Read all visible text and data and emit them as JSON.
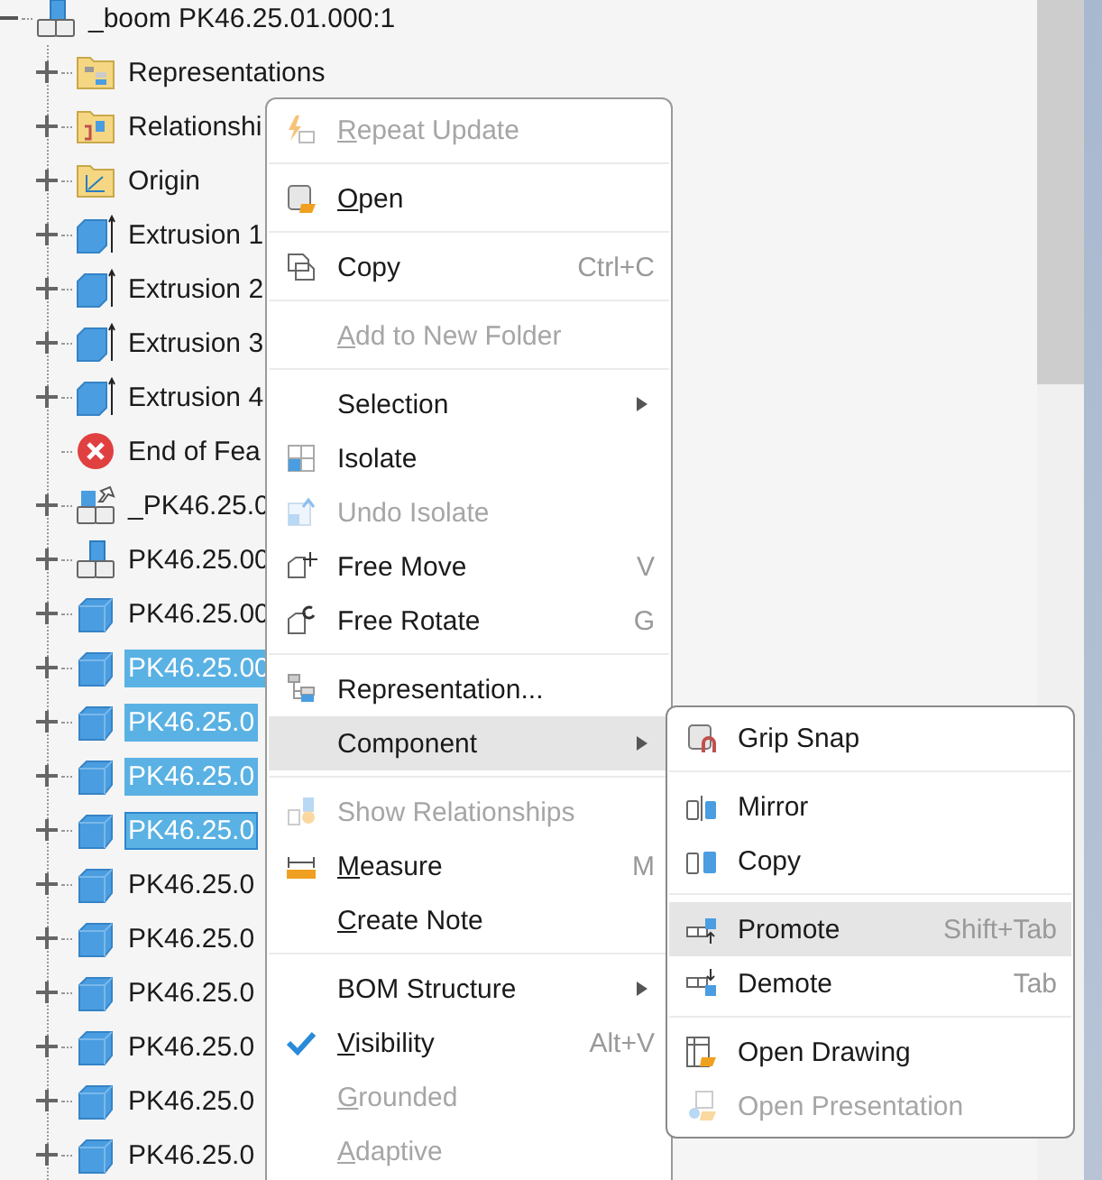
{
  "tree": {
    "root": {
      "label": "_boom PK46.25.01.000:1",
      "kind": "assembly",
      "expanded": true,
      "selected": false,
      "focused": false,
      "children": [
        {
          "label": "Representations",
          "kind": "representations",
          "expanded": false,
          "selected": false,
          "focused": false
        },
        {
          "label": "Relationshi",
          "kind": "relationships",
          "expanded": false,
          "selected": false,
          "focused": false
        },
        {
          "label": "Origin",
          "kind": "origin",
          "expanded": false,
          "selected": false,
          "focused": false
        },
        {
          "label": "Extrusion 1",
          "kind": "extrusion",
          "expanded": false,
          "selected": false,
          "focused": false
        },
        {
          "label": "Extrusion 2",
          "kind": "extrusion",
          "expanded": false,
          "selected": false,
          "focused": false
        },
        {
          "label": "Extrusion 3",
          "kind": "extrusion",
          "expanded": false,
          "selected": false,
          "focused": false
        },
        {
          "label": "Extrusion 4",
          "kind": "extrusion",
          "expanded": false,
          "selected": false,
          "focused": false
        },
        {
          "label": "End of Fea",
          "kind": "error",
          "selected": false,
          "focused": false
        },
        {
          "label": "_PK46.25.0",
          "kind": "pinned",
          "expanded": false,
          "selected": false,
          "focused": false
        },
        {
          "label": "PK46.25.00",
          "kind": "subassembly",
          "expanded": false,
          "selected": false,
          "focused": false
        },
        {
          "label": "PK46.25.00",
          "kind": "part",
          "expanded": false,
          "selected": false,
          "focused": false
        },
        {
          "label": "PK46.25.00",
          "kind": "part",
          "expanded": false,
          "selected": true,
          "focused": false
        },
        {
          "label": "PK46.25.0",
          "kind": "part",
          "expanded": false,
          "selected": true,
          "focused": false
        },
        {
          "label": "PK46.25.0",
          "kind": "part",
          "expanded": false,
          "selected": true,
          "focused": false
        },
        {
          "label": "PK46.25.0",
          "kind": "part",
          "expanded": false,
          "selected": true,
          "focused": true
        },
        {
          "label": "PK46.25.0",
          "kind": "part",
          "expanded": false,
          "selected": false,
          "focused": false
        },
        {
          "label": "PK46.25.0",
          "kind": "part",
          "expanded": false,
          "selected": false,
          "focused": false
        },
        {
          "label": "PK46.25.0",
          "kind": "part",
          "expanded": false,
          "selected": false,
          "focused": false
        },
        {
          "label": "PK46.25.0",
          "kind": "part",
          "expanded": false,
          "selected": false,
          "focused": false
        },
        {
          "label": "PK46.25.0",
          "kind": "part",
          "expanded": false,
          "selected": false,
          "focused": false
        },
        {
          "label": "PK46.25.0",
          "kind": "part",
          "expanded": false,
          "selected": false,
          "focused": false
        }
      ]
    }
  },
  "context_menu": {
    "groups": [
      [
        {
          "label": "Repeat Update",
          "disabled": true,
          "underline": true,
          "highlighted": false,
          "checked": false,
          "submenu": false
        }
      ],
      [
        {
          "label": "Open",
          "disabled": false,
          "underline": true,
          "highlighted": false,
          "checked": false,
          "submenu": false
        }
      ],
      [
        {
          "label": "Copy",
          "shortcut": "Ctrl+C",
          "disabled": false,
          "underline": false,
          "highlighted": false,
          "checked": false,
          "submenu": false
        }
      ],
      [
        {
          "label": "Add to New Folder",
          "disabled": true,
          "underline": true,
          "highlighted": false,
          "checked": false,
          "submenu": false
        }
      ],
      [
        {
          "label": "Selection",
          "disabled": false,
          "underline": false,
          "highlighted": false,
          "checked": false,
          "submenu": true
        },
        {
          "label": "Isolate",
          "disabled": false,
          "underline": false,
          "highlighted": false,
          "checked": false,
          "submenu": false
        },
        {
          "label": "Undo Isolate",
          "disabled": true,
          "underline": false,
          "highlighted": false,
          "checked": false,
          "submenu": false
        },
        {
          "label": "Free Move",
          "shortcut": "V",
          "disabled": false,
          "underline": false,
          "highlighted": false,
          "checked": false,
          "submenu": false
        },
        {
          "label": "Free Rotate",
          "shortcut": "G",
          "disabled": false,
          "underline": false,
          "highlighted": false,
          "checked": false,
          "submenu": false
        }
      ],
      [
        {
          "label": "Representation...",
          "disabled": false,
          "underline": false,
          "highlighted": false,
          "checked": false,
          "submenu": false
        },
        {
          "label": "Component",
          "disabled": false,
          "underline": false,
          "highlighted": true,
          "checked": false,
          "submenu": true
        }
      ],
      [
        {
          "label": "Show Relationships",
          "disabled": true,
          "underline": false,
          "highlighted": false,
          "checked": false,
          "submenu": false
        },
        {
          "label": "Measure",
          "shortcut": "M",
          "disabled": false,
          "underline": true,
          "highlighted": false,
          "checked": false,
          "submenu": false
        },
        {
          "label": "Create Note",
          "disabled": false,
          "underline": true,
          "highlighted": false,
          "checked": false,
          "submenu": false
        }
      ],
      [
        {
          "label": "BOM Structure",
          "disabled": false,
          "underline": false,
          "highlighted": false,
          "checked": false,
          "submenu": true
        },
        {
          "label": "Visibility",
          "shortcut": "Alt+V",
          "disabled": false,
          "underline": true,
          "highlighted": false,
          "checked": true,
          "submenu": false
        },
        {
          "label": "Grounded",
          "disabled": true,
          "underline": true,
          "highlighted": false,
          "checked": false,
          "submenu": false
        },
        {
          "label": "Adaptive",
          "disabled": true,
          "underline": true,
          "highlighted": false,
          "checked": false,
          "submenu": false
        }
      ]
    ]
  },
  "submenu": {
    "groups": [
      [
        {
          "label": "Grip Snap",
          "disabled": false,
          "highlighted": false
        }
      ],
      [
        {
          "label": "Mirror",
          "disabled": false,
          "highlighted": false
        },
        {
          "label": "Copy",
          "disabled": false,
          "highlighted": false
        }
      ],
      [
        {
          "label": "Promote",
          "shortcut": "Shift+Tab",
          "disabled": false,
          "highlighted": true
        },
        {
          "label": "Demote",
          "shortcut": "Tab",
          "disabled": false,
          "highlighted": false
        }
      ],
      [
        {
          "label": "Open Drawing",
          "disabled": false,
          "highlighted": false
        },
        {
          "label": "Open Presentation",
          "disabled": true,
          "highlighted": false
        }
      ]
    ]
  }
}
